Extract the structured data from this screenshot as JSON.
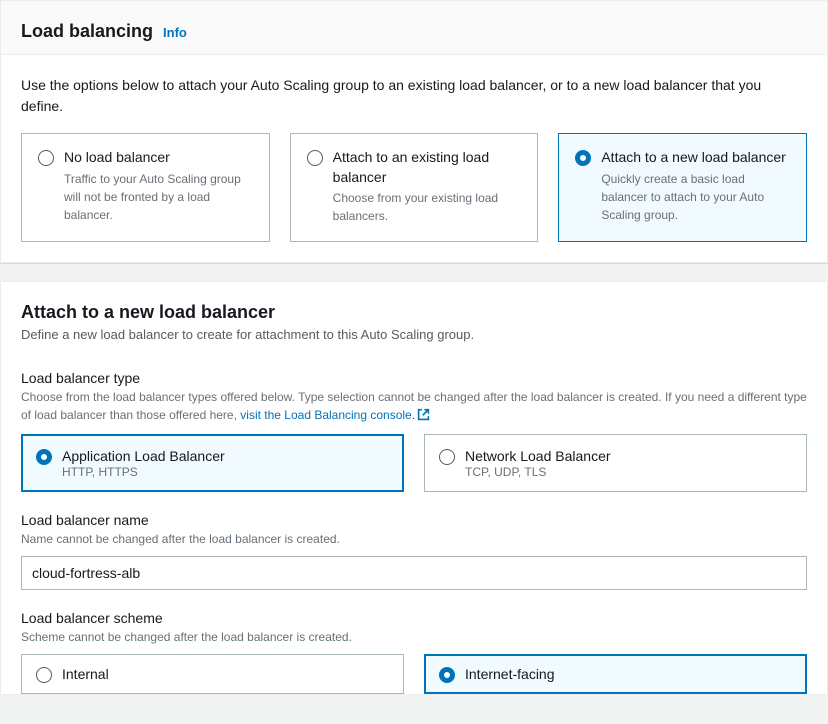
{
  "header": {
    "title": "Load balancing",
    "info": "Info"
  },
  "intro": "Use the options below to attach your Auto Scaling group to an existing load balancer, or to a new load balancer that you define.",
  "options": [
    {
      "title": "No load balancer",
      "desc": "Traffic to your Auto Scaling group will not be fronted by a load balancer.",
      "selected": false
    },
    {
      "title": "Attach to an existing load balancer",
      "desc": "Choose from your existing load balancers.",
      "selected": false
    },
    {
      "title": "Attach to a new load balancer",
      "desc": "Quickly create a basic load balancer to attach to your Auto Scaling group.",
      "selected": true
    }
  ],
  "newlb": {
    "title": "Attach to a new load balancer",
    "sub": "Define a new load balancer to create for attachment to this Auto Scaling group."
  },
  "lbtype": {
    "label": "Load balancer type",
    "help_prefix": "Choose from the load balancer types offered below. Type selection cannot be changed after the load balancer is created. If you need a different type of load balancer than those offered here, ",
    "help_link": "visit the Load Balancing console.",
    "options": [
      {
        "title": "Application Load Balancer",
        "sub": "HTTP, HTTPS",
        "selected": true
      },
      {
        "title": "Network Load Balancer",
        "sub": "TCP, UDP, TLS",
        "selected": false
      }
    ]
  },
  "lbname": {
    "label": "Load balancer name",
    "help": "Name cannot be changed after the load balancer is created.",
    "value": "cloud-fortress-alb"
  },
  "scheme": {
    "label": "Load balancer scheme",
    "help": "Scheme cannot be changed after the load balancer is created.",
    "options": [
      {
        "label": "Internal",
        "selected": false
      },
      {
        "label": "Internet-facing",
        "selected": true
      }
    ]
  }
}
